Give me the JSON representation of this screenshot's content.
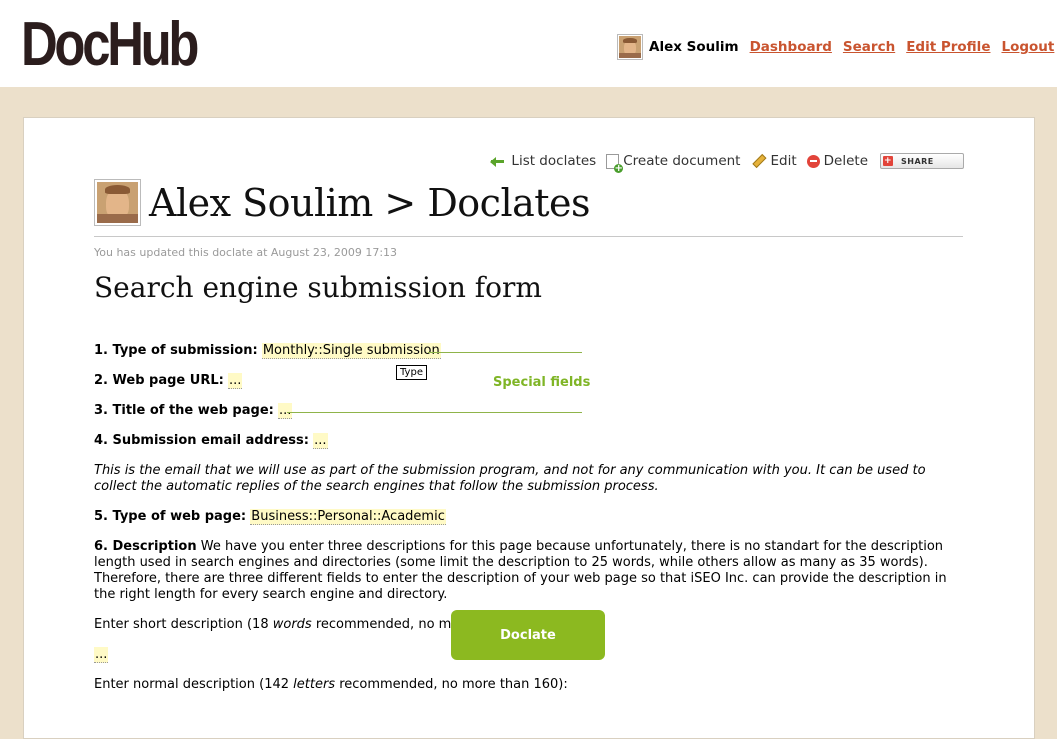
{
  "header": {
    "logo": "DocHub",
    "user_name": "Alex Soulim",
    "links": [
      "Dashboard",
      "Search",
      "Edit Profile",
      "Logout"
    ]
  },
  "toolbar": {
    "list_doclates": "List doclates",
    "create_document": "Create document",
    "edit": "Edit",
    "delete": "Delete",
    "share": "SHARE"
  },
  "page": {
    "title": "Alex Soulim > Doclates",
    "update_note": "You has updated this doclate at August 23, 2009 17:13",
    "doc_title": "Search engine submission form"
  },
  "form": {
    "q1_label": "1. Type of submission:",
    "q1_value": "Monthly::Single submission",
    "type_tooltip": "Type",
    "special_fields": "Special fields",
    "q2_label": "2. Web page URL:",
    "q2_value": "...",
    "q3_label": "3. Title of the web page:",
    "q3_value": "...",
    "q4_label": "4. Submission email address:",
    "q4_value": "...",
    "q4_note": "This is the email that we will use as part of the submission program, and not for any communication with you. It can be used to collect the automatic replies of the search engines that follow the submission process.",
    "q5_label": "5. Type of web page:",
    "q5_value": "Business::Personal::Academic",
    "q6_label": "6. Description",
    "q6_text": "We have you enter three descriptions for this page because unfortunately, there is no standart for the description length used in search engines and directories (some limit the description to 25 words, while others allow as many as 35 words). Therefore, there are three different fields to enter the description of your web page so that iSEO Inc. can provide the description in the right length for every search engine and directory.",
    "short_desc_pre": "Enter short description (18 ",
    "short_desc_em": "words",
    "short_desc_post": " recommended, no more",
    "short_desc_value": "...",
    "normal_desc_pre": "Enter normal description (142 ",
    "normal_desc_em": "letters",
    "normal_desc_post": " recommended, no more than 160):"
  },
  "doclate_button": "Doclate"
}
